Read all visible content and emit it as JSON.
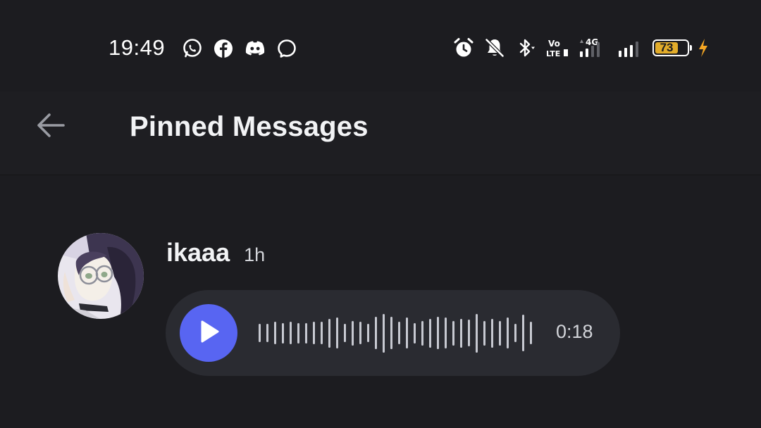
{
  "status_bar": {
    "time": "19:49",
    "notification_icons": [
      "whatsapp-icon",
      "facebook-icon",
      "discord-icon",
      "messenger-icon"
    ],
    "system_icons": [
      "alarm-icon",
      "bell-muted-icon",
      "bluetooth-icon",
      "volte-icon",
      "signal-4g-icon",
      "signal-icon",
      "battery-icon",
      "charging-icon"
    ],
    "volte_text": "Vo LTE",
    "network_type": "4G",
    "battery_level": "73",
    "battery_color": "#e2ac2a",
    "charging_color": "#f5a623"
  },
  "header": {
    "title": "Pinned Messages",
    "back_icon": "arrow-left-icon"
  },
  "message": {
    "author": "ikaaa",
    "timestamp": "1h",
    "voice": {
      "duration": "0:18",
      "accent_color": "#5865f2",
      "waveform_levels": [
        0.45,
        0.45,
        0.55,
        0.5,
        0.55,
        0.5,
        0.5,
        0.55,
        0.55,
        0.7,
        0.75,
        0.45,
        0.6,
        0.55,
        0.45,
        0.8,
        0.95,
        0.8,
        0.55,
        0.75,
        0.5,
        0.6,
        0.7,
        0.8,
        0.75,
        0.6,
        0.7,
        0.65,
        0.95,
        0.6,
        0.7,
        0.6,
        0.75,
        0.45,
        0.9,
        0.55
      ]
    }
  }
}
